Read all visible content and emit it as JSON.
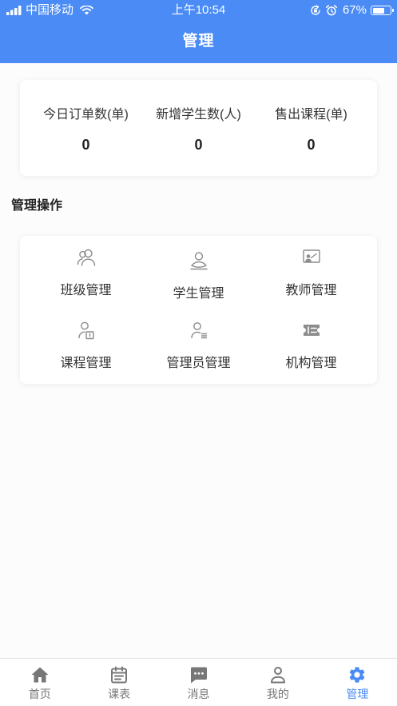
{
  "colors": {
    "primary": "#4a8bf5",
    "text": "#333333",
    "muted": "#777777",
    "icon": "#8c8c8c"
  },
  "status_bar": {
    "carrier": "中国移动",
    "time": "上午10:54",
    "battery_text": "67%",
    "battery_level": 0.67,
    "icons": [
      "signal-icon",
      "wifi-icon",
      "rotation-lock-icon",
      "alarm-icon",
      "battery-icon"
    ]
  },
  "header": {
    "title": "管理"
  },
  "stats": [
    {
      "label": "今日订单数(单)",
      "value": "0"
    },
    {
      "label": "新增学生数(人)",
      "value": "0"
    },
    {
      "label": "售出课程(单)",
      "value": "0"
    }
  ],
  "section": {
    "title": "管理操作"
  },
  "operations": [
    {
      "label": "班级管理",
      "icon": "class-group-icon"
    },
    {
      "label": "学生管理",
      "icon": "student-icon"
    },
    {
      "label": "教师管理",
      "icon": "teacher-board-icon"
    },
    {
      "label": "课程管理",
      "icon": "course-icon"
    },
    {
      "label": "管理员管理",
      "icon": "admin-icon"
    },
    {
      "label": "机构管理",
      "icon": "institution-ticket-icon"
    }
  ],
  "tabbar": {
    "items": [
      {
        "label": "首页",
        "icon": "home-icon",
        "active": false
      },
      {
        "label": "课表",
        "icon": "calendar-icon",
        "active": false
      },
      {
        "label": "消息",
        "icon": "message-icon",
        "active": false
      },
      {
        "label": "我的",
        "icon": "user-icon",
        "active": false
      },
      {
        "label": "管理",
        "icon": "gear-icon",
        "active": true
      }
    ]
  }
}
